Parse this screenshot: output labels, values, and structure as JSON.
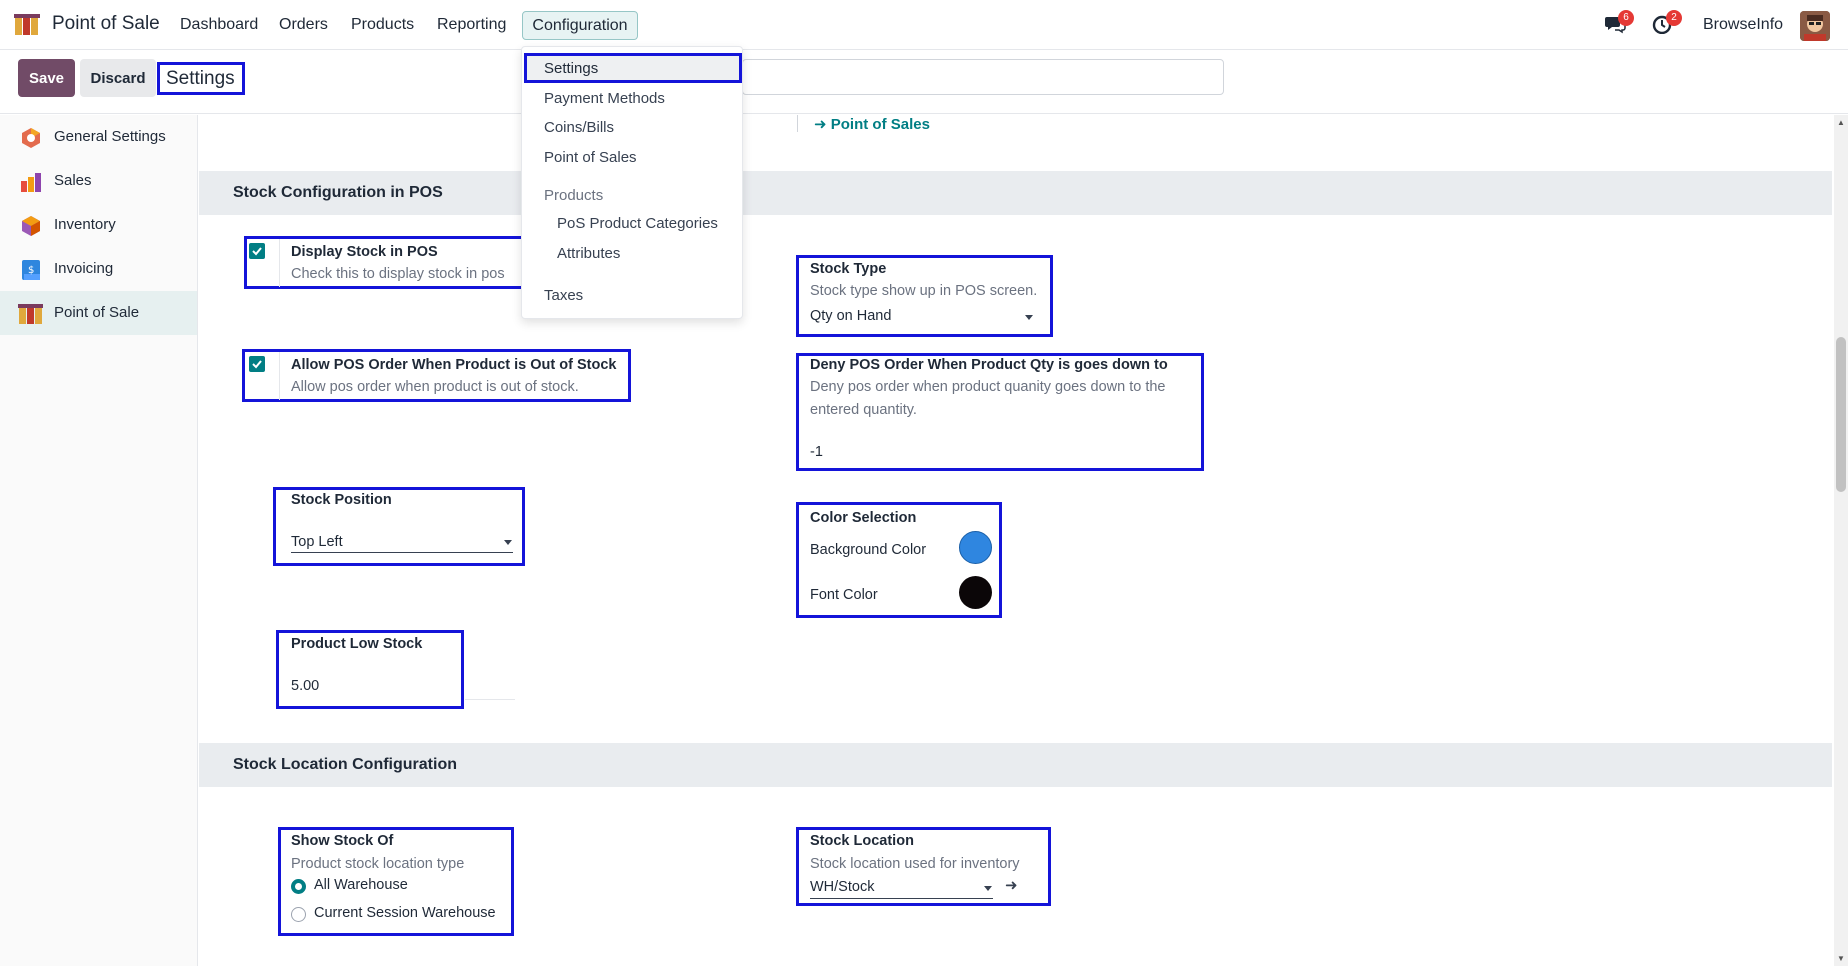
{
  "navbar": {
    "app_name": "Point of Sale",
    "menus": [
      "Dashboard",
      "Orders",
      "Products",
      "Reporting"
    ],
    "active_menu": "Configuration",
    "messages_count": "6",
    "activities_count": "2",
    "company": "BrowseInfo"
  },
  "control_panel": {
    "save_label": "Save",
    "discard_label": "Discard",
    "title": "Settings",
    "search_placeholder": ""
  },
  "dropdown": {
    "items": [
      "Settings",
      "Payment Methods",
      "Coins/Bills",
      "Point of Sales"
    ],
    "group_heading": "Products",
    "sub_items": [
      "PoS Product Categories",
      "Attributes"
    ],
    "last_item": "Taxes"
  },
  "sidebar": {
    "items": [
      {
        "label": "General Settings"
      },
      {
        "label": "Sales"
      },
      {
        "label": "Inventory"
      },
      {
        "label": "Invoicing"
      },
      {
        "label": "Point of Sale"
      }
    ]
  },
  "main": {
    "pos_link": "Point of Sales",
    "section_stock": {
      "title": "Stock Configuration in POS",
      "display_stock": {
        "title": "Display Stock in POS",
        "desc": "Check this to display stock in pos",
        "checked": true
      },
      "stock_type": {
        "title": "Stock Type",
        "desc": "Stock type show up in POS screen.",
        "value": "Qty on Hand"
      },
      "allow_order": {
        "title": "Allow POS Order When Product is Out of Stock",
        "desc": "Allow pos order when product is out of stock.",
        "checked": true
      },
      "deny_order": {
        "title": "Deny POS Order When Product Qty is goes down to",
        "desc_line1": "Deny pos order when product quanity goes down to the",
        "desc_line2": "entered quantity.",
        "value": "-1"
      },
      "stock_position": {
        "title": "Stock Position",
        "value": "Top Left"
      },
      "color_selection": {
        "title": "Color Selection",
        "bg_label": "Background Color",
        "bg_color": "#2f86e0",
        "font_label": "Font Color",
        "font_color": "#0b0608"
      },
      "low_stock": {
        "title": "Product Low Stock",
        "value": "5.00"
      }
    },
    "section_location": {
      "title": "Stock Location Configuration",
      "show_stock_of": {
        "title": "Show Stock Of",
        "desc": "Product stock location type",
        "options": [
          "All Warehouse",
          "Current Session Warehouse"
        ],
        "selected": "All Warehouse"
      },
      "stock_location": {
        "title": "Stock Location",
        "desc": "Stock location used for inventory",
        "value": "WH/Stock"
      }
    }
  },
  "colors": {
    "brand": "#714b67",
    "accent": "#017e84",
    "highlight_box": "#1414d9"
  }
}
